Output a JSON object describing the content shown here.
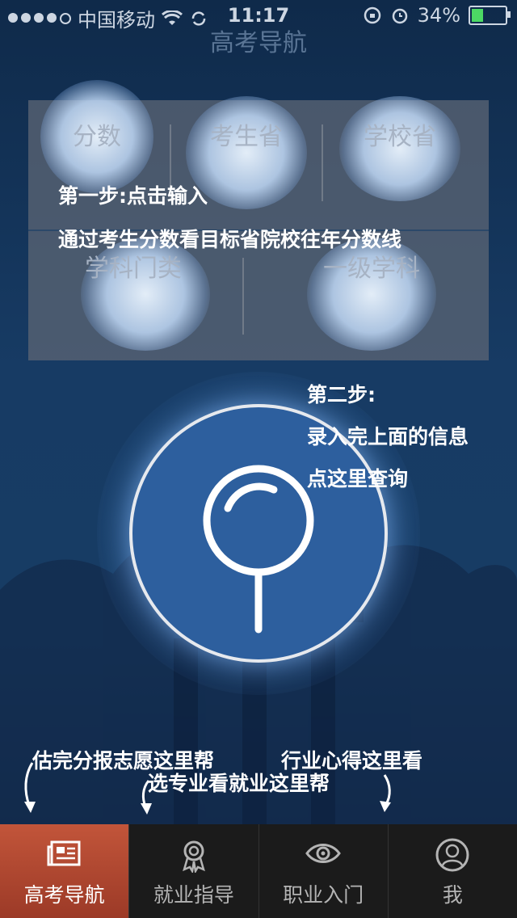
{
  "status_bar": {
    "carrier": "中国移动",
    "time": "11:17",
    "battery": "34%",
    "battery_level": 0.34
  },
  "nav": {
    "title": "高考导航"
  },
  "form": {
    "score_label": "分数",
    "student_province_label": "考生省",
    "school_province_label": "学校省",
    "subject_category_label": "学科门类",
    "first_level_subject_label": "一级学科"
  },
  "tips": {
    "step1_title": "第一步:点击输入",
    "step1_desc": "通过考生分数看目标省院校往年分数线",
    "step2_title": "第二步:",
    "step2_line1": "录入完上面的信息",
    "step2_line2": "点这里查询"
  },
  "hints": {
    "hint1": "估完分报志愿这里帮",
    "hint2": "选专业看就业这里帮",
    "hint3": "行业心得这里看"
  },
  "tabbar": {
    "tabs": [
      {
        "label": "高考导航",
        "icon": "newspaper-icon",
        "active": true
      },
      {
        "label": "就业指导",
        "icon": "badge-icon",
        "active": false
      },
      {
        "label": "职业入门",
        "icon": "eye-icon",
        "active": false
      },
      {
        "label": "我",
        "icon": "user-icon",
        "active": false
      }
    ]
  },
  "colors": {
    "background": "#173b64",
    "active_tab": "#b44a32",
    "search_fill": "#2d5f9e"
  }
}
